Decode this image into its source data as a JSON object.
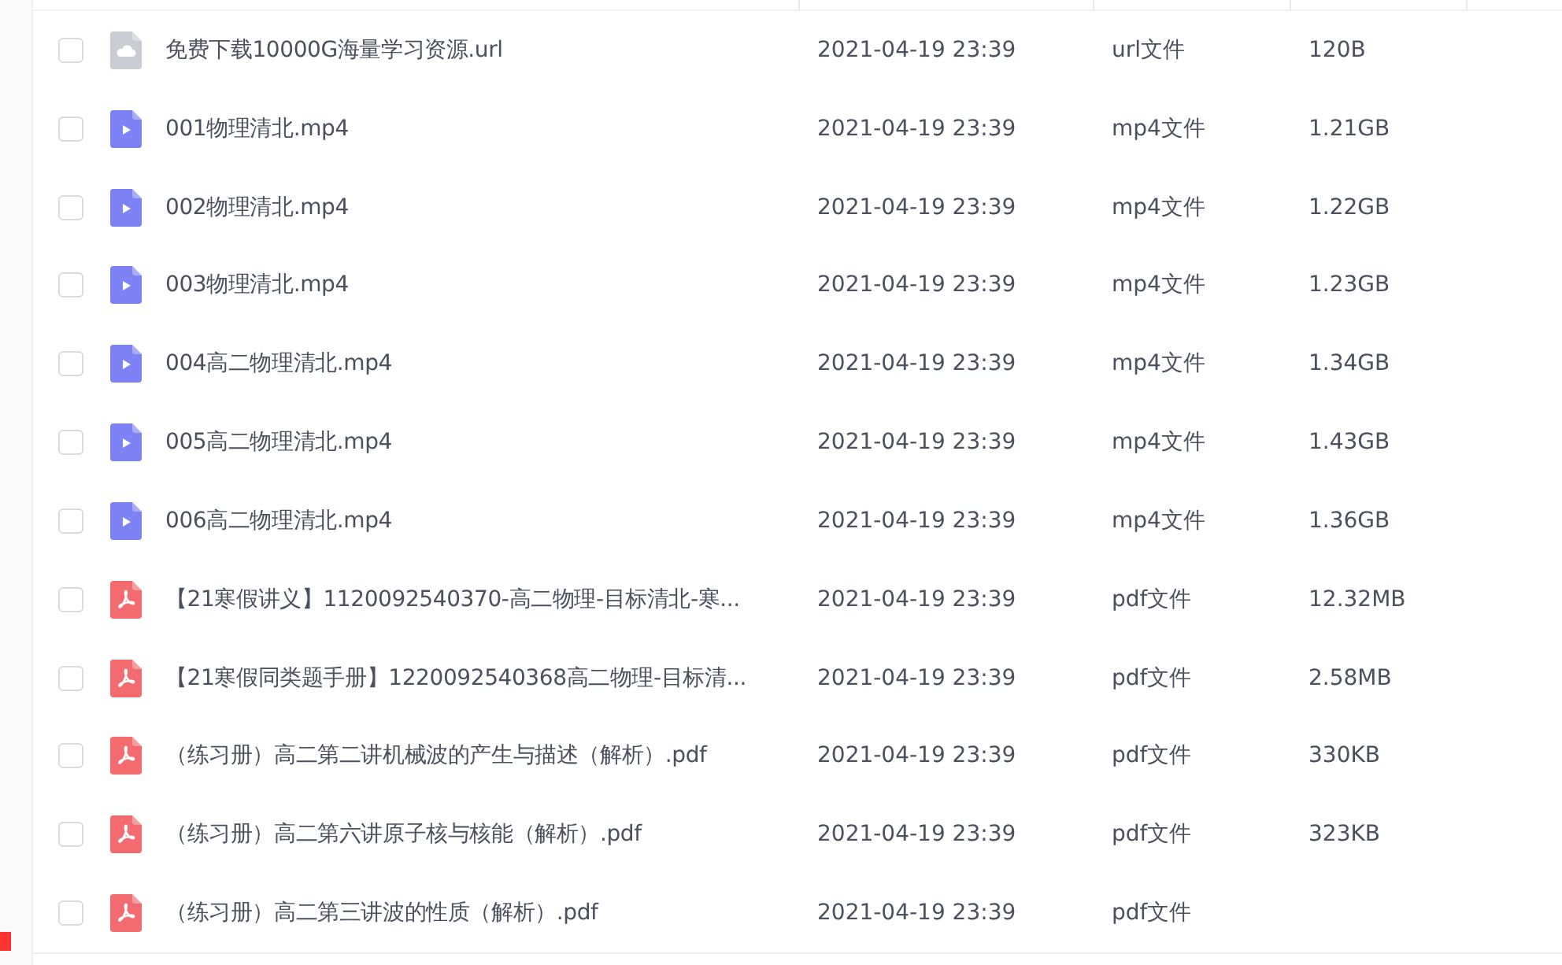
{
  "files": [
    {
      "kind": "url",
      "name": "免费下载10000G海量学习资源.url",
      "modified": "2021-04-19 23:39",
      "type": "url文件",
      "size": "120B",
      "checked": false
    },
    {
      "kind": "video",
      "name": "001物理清北.mp4",
      "modified": "2021-04-19 23:39",
      "type": "mp4文件",
      "size": "1.21GB",
      "checked": false
    },
    {
      "kind": "video",
      "name": "002物理清北.mp4",
      "modified": "2021-04-19 23:39",
      "type": "mp4文件",
      "size": "1.22GB",
      "checked": false
    },
    {
      "kind": "video",
      "name": "003物理清北.mp4",
      "modified": "2021-04-19 23:39",
      "type": "mp4文件",
      "size": "1.23GB",
      "checked": false
    },
    {
      "kind": "video",
      "name": "004高二物理清北.mp4",
      "modified": "2021-04-19 23:39",
      "type": "mp4文件",
      "size": "1.34GB",
      "checked": false
    },
    {
      "kind": "video",
      "name": "005高二物理清北.mp4",
      "modified": "2021-04-19 23:39",
      "type": "mp4文件",
      "size": "1.43GB",
      "checked": false
    },
    {
      "kind": "video",
      "name": "006高二物理清北.mp4",
      "modified": "2021-04-19 23:39",
      "type": "mp4文件",
      "size": "1.36GB",
      "checked": false
    },
    {
      "kind": "pdf",
      "name": "【21寒假讲义】1120092540370-高二物理-目标清北-寒...",
      "modified": "2021-04-19 23:39",
      "type": "pdf文件",
      "size": "12.32MB",
      "checked": false
    },
    {
      "kind": "pdf",
      "name": "【21寒假同类题手册】1220092540368高二物理-目标清...",
      "modified": "2021-04-19 23:39",
      "type": "pdf文件",
      "size": "2.58MB",
      "checked": false
    },
    {
      "kind": "pdf",
      "name": "（练习册）高二第二讲机械波的产生与描述（解析）.pdf",
      "modified": "2021-04-19 23:39",
      "type": "pdf文件",
      "size": "330KB",
      "checked": false
    },
    {
      "kind": "pdf",
      "name": "（练习册）高二第六讲原子核与核能（解析）.pdf",
      "modified": "2021-04-19 23:39",
      "type": "pdf文件",
      "size": "323KB",
      "checked": false
    },
    {
      "kind": "pdf",
      "name": "（练习册）高二第三讲波的性质（解析）.pdf",
      "modified": "2021-04-19 23:39",
      "type": "pdf文件",
      "checked": false
    }
  ]
}
